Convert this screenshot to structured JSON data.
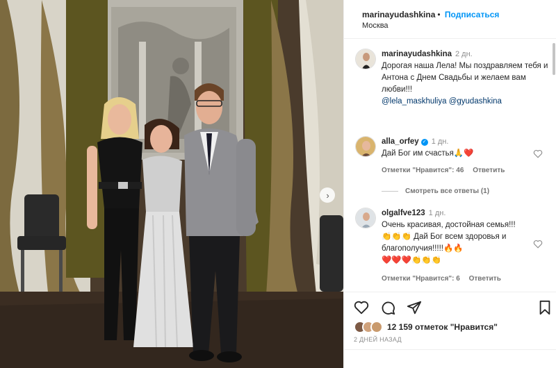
{
  "header": {
    "username": "marinayudashkina",
    "separator": "•",
    "follow_label": "Подписаться",
    "location": "Москва"
  },
  "caption": {
    "username": "marinayudashkina",
    "time": "2 дн.",
    "text": "Дорогая наша Лела! Мы поздравляем тебя и Антона с Днем Свадьбы и желаем вам любви!!!",
    "mentions": [
      "@lela_maskhuliya",
      "@gyudashkina"
    ]
  },
  "comments": [
    {
      "username": "alla_orfey",
      "verified_mark": "✓",
      "time": "1 дн.",
      "text": "Дай Бог им счастья🙏❤️",
      "likes_label": "Отметки \"Нравится\": 46",
      "reply_label": "Ответить",
      "view_replies_label": "Смотреть все ответы (1)"
    },
    {
      "username": "olgalfve123",
      "time": "1 дн.",
      "text": "Очень красивая, достойная семья!!! 👏👏👏 Дай Бог всем здоровья и благополучия!!!!!🔥🔥",
      "hearts": "❤️❤️❤️👏👏👏",
      "likes_label": "Отметки \"Нравится\": 6",
      "reply_label": "Ответить"
    }
  ],
  "actions": {
    "icons": [
      "heart-icon",
      "comment-icon",
      "share-icon",
      "bookmark-icon"
    ]
  },
  "likes": {
    "count_label": "12 159 отметок \"Нравится\""
  },
  "post_date": "2 ДНЕЙ НАЗАД",
  "colors": {
    "link_blue": "#0095f6",
    "mention": "#00376b",
    "muted": "#737373"
  }
}
